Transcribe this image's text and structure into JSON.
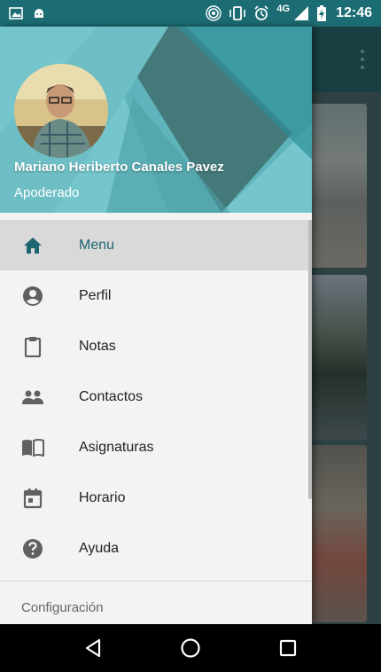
{
  "status_bar": {
    "time": "12:46",
    "network": "4G",
    "left_icons": [
      "gallery-icon",
      "android-icon"
    ],
    "right_icons": [
      "hotspot-icon",
      "vibrate-icon",
      "alarm-icon",
      "signal-icon",
      "battery-charging-icon"
    ]
  },
  "drawer": {
    "profile": {
      "name": "Mariano Heriberto Canales Pavez",
      "role": "Apoderado"
    },
    "menu": [
      {
        "label": "Menu",
        "icon": "home-icon",
        "active": true
      },
      {
        "label": "Perfil",
        "icon": "account-circle-icon",
        "active": false
      },
      {
        "label": "Notas",
        "icon": "clipboard-icon",
        "active": false
      },
      {
        "label": "Contactos",
        "icon": "people-icon",
        "active": false
      },
      {
        "label": "Asignaturas",
        "icon": "book-icon",
        "active": false
      },
      {
        "label": "Horario",
        "icon": "calendar-icon",
        "active": false
      },
      {
        "label": "Ayuda",
        "icon": "help-icon",
        "active": false
      }
    ],
    "section_label": "Configuración"
  },
  "nav_bar": {
    "buttons": [
      "back-icon",
      "home-circle-icon",
      "recents-icon"
    ]
  },
  "colors": {
    "status_bar": "#1b6d73",
    "header": "#74c6cc",
    "active_item": "#d9d9d9",
    "accent": "#1e6670"
  }
}
